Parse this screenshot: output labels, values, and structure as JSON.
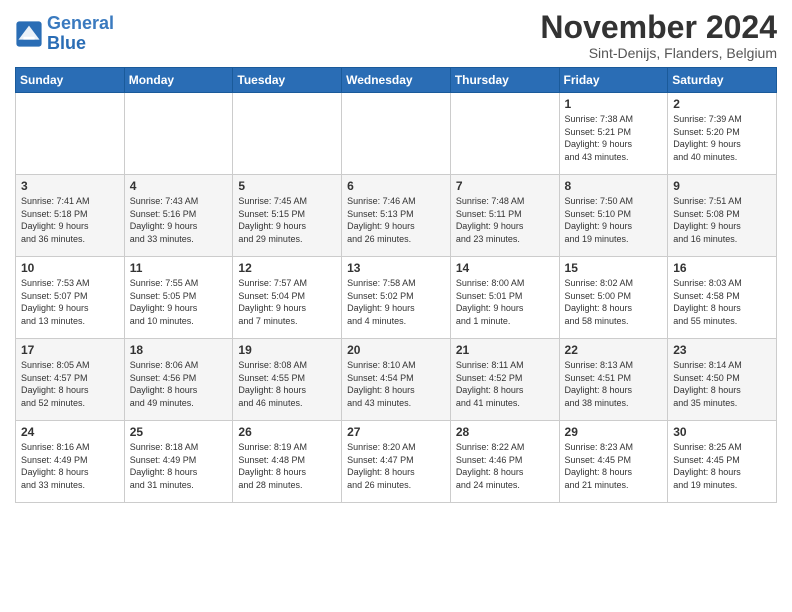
{
  "header": {
    "logo_text_1": "General",
    "logo_text_2": "Blue",
    "month_title": "November 2024",
    "subtitle": "Sint-Denijs, Flanders, Belgium"
  },
  "days_of_week": [
    "Sunday",
    "Monday",
    "Tuesday",
    "Wednesday",
    "Thursday",
    "Friday",
    "Saturday"
  ],
  "weeks": [
    [
      {
        "day": "",
        "info": ""
      },
      {
        "day": "",
        "info": ""
      },
      {
        "day": "",
        "info": ""
      },
      {
        "day": "",
        "info": ""
      },
      {
        "day": "",
        "info": ""
      },
      {
        "day": "1",
        "info": "Sunrise: 7:38 AM\nSunset: 5:21 PM\nDaylight: 9 hours\nand 43 minutes."
      },
      {
        "day": "2",
        "info": "Sunrise: 7:39 AM\nSunset: 5:20 PM\nDaylight: 9 hours\nand 40 minutes."
      }
    ],
    [
      {
        "day": "3",
        "info": "Sunrise: 7:41 AM\nSunset: 5:18 PM\nDaylight: 9 hours\nand 36 minutes."
      },
      {
        "day": "4",
        "info": "Sunrise: 7:43 AM\nSunset: 5:16 PM\nDaylight: 9 hours\nand 33 minutes."
      },
      {
        "day": "5",
        "info": "Sunrise: 7:45 AM\nSunset: 5:15 PM\nDaylight: 9 hours\nand 29 minutes."
      },
      {
        "day": "6",
        "info": "Sunrise: 7:46 AM\nSunset: 5:13 PM\nDaylight: 9 hours\nand 26 minutes."
      },
      {
        "day": "7",
        "info": "Sunrise: 7:48 AM\nSunset: 5:11 PM\nDaylight: 9 hours\nand 23 minutes."
      },
      {
        "day": "8",
        "info": "Sunrise: 7:50 AM\nSunset: 5:10 PM\nDaylight: 9 hours\nand 19 minutes."
      },
      {
        "day": "9",
        "info": "Sunrise: 7:51 AM\nSunset: 5:08 PM\nDaylight: 9 hours\nand 16 minutes."
      }
    ],
    [
      {
        "day": "10",
        "info": "Sunrise: 7:53 AM\nSunset: 5:07 PM\nDaylight: 9 hours\nand 13 minutes."
      },
      {
        "day": "11",
        "info": "Sunrise: 7:55 AM\nSunset: 5:05 PM\nDaylight: 9 hours\nand 10 minutes."
      },
      {
        "day": "12",
        "info": "Sunrise: 7:57 AM\nSunset: 5:04 PM\nDaylight: 9 hours\nand 7 minutes."
      },
      {
        "day": "13",
        "info": "Sunrise: 7:58 AM\nSunset: 5:02 PM\nDaylight: 9 hours\nand 4 minutes."
      },
      {
        "day": "14",
        "info": "Sunrise: 8:00 AM\nSunset: 5:01 PM\nDaylight: 9 hours\nand 1 minute."
      },
      {
        "day": "15",
        "info": "Sunrise: 8:02 AM\nSunset: 5:00 PM\nDaylight: 8 hours\nand 58 minutes."
      },
      {
        "day": "16",
        "info": "Sunrise: 8:03 AM\nSunset: 4:58 PM\nDaylight: 8 hours\nand 55 minutes."
      }
    ],
    [
      {
        "day": "17",
        "info": "Sunrise: 8:05 AM\nSunset: 4:57 PM\nDaylight: 8 hours\nand 52 minutes."
      },
      {
        "day": "18",
        "info": "Sunrise: 8:06 AM\nSunset: 4:56 PM\nDaylight: 8 hours\nand 49 minutes."
      },
      {
        "day": "19",
        "info": "Sunrise: 8:08 AM\nSunset: 4:55 PM\nDaylight: 8 hours\nand 46 minutes."
      },
      {
        "day": "20",
        "info": "Sunrise: 8:10 AM\nSunset: 4:54 PM\nDaylight: 8 hours\nand 43 minutes."
      },
      {
        "day": "21",
        "info": "Sunrise: 8:11 AM\nSunset: 4:52 PM\nDaylight: 8 hours\nand 41 minutes."
      },
      {
        "day": "22",
        "info": "Sunrise: 8:13 AM\nSunset: 4:51 PM\nDaylight: 8 hours\nand 38 minutes."
      },
      {
        "day": "23",
        "info": "Sunrise: 8:14 AM\nSunset: 4:50 PM\nDaylight: 8 hours\nand 35 minutes."
      }
    ],
    [
      {
        "day": "24",
        "info": "Sunrise: 8:16 AM\nSunset: 4:49 PM\nDaylight: 8 hours\nand 33 minutes."
      },
      {
        "day": "25",
        "info": "Sunrise: 8:18 AM\nSunset: 4:49 PM\nDaylight: 8 hours\nand 31 minutes."
      },
      {
        "day": "26",
        "info": "Sunrise: 8:19 AM\nSunset: 4:48 PM\nDaylight: 8 hours\nand 28 minutes."
      },
      {
        "day": "27",
        "info": "Sunrise: 8:20 AM\nSunset: 4:47 PM\nDaylight: 8 hours\nand 26 minutes."
      },
      {
        "day": "28",
        "info": "Sunrise: 8:22 AM\nSunset: 4:46 PM\nDaylight: 8 hours\nand 24 minutes."
      },
      {
        "day": "29",
        "info": "Sunrise: 8:23 AM\nSunset: 4:45 PM\nDaylight: 8 hours\nand 21 minutes."
      },
      {
        "day": "30",
        "info": "Sunrise: 8:25 AM\nSunset: 4:45 PM\nDaylight: 8 hours\nand 19 minutes."
      }
    ]
  ]
}
